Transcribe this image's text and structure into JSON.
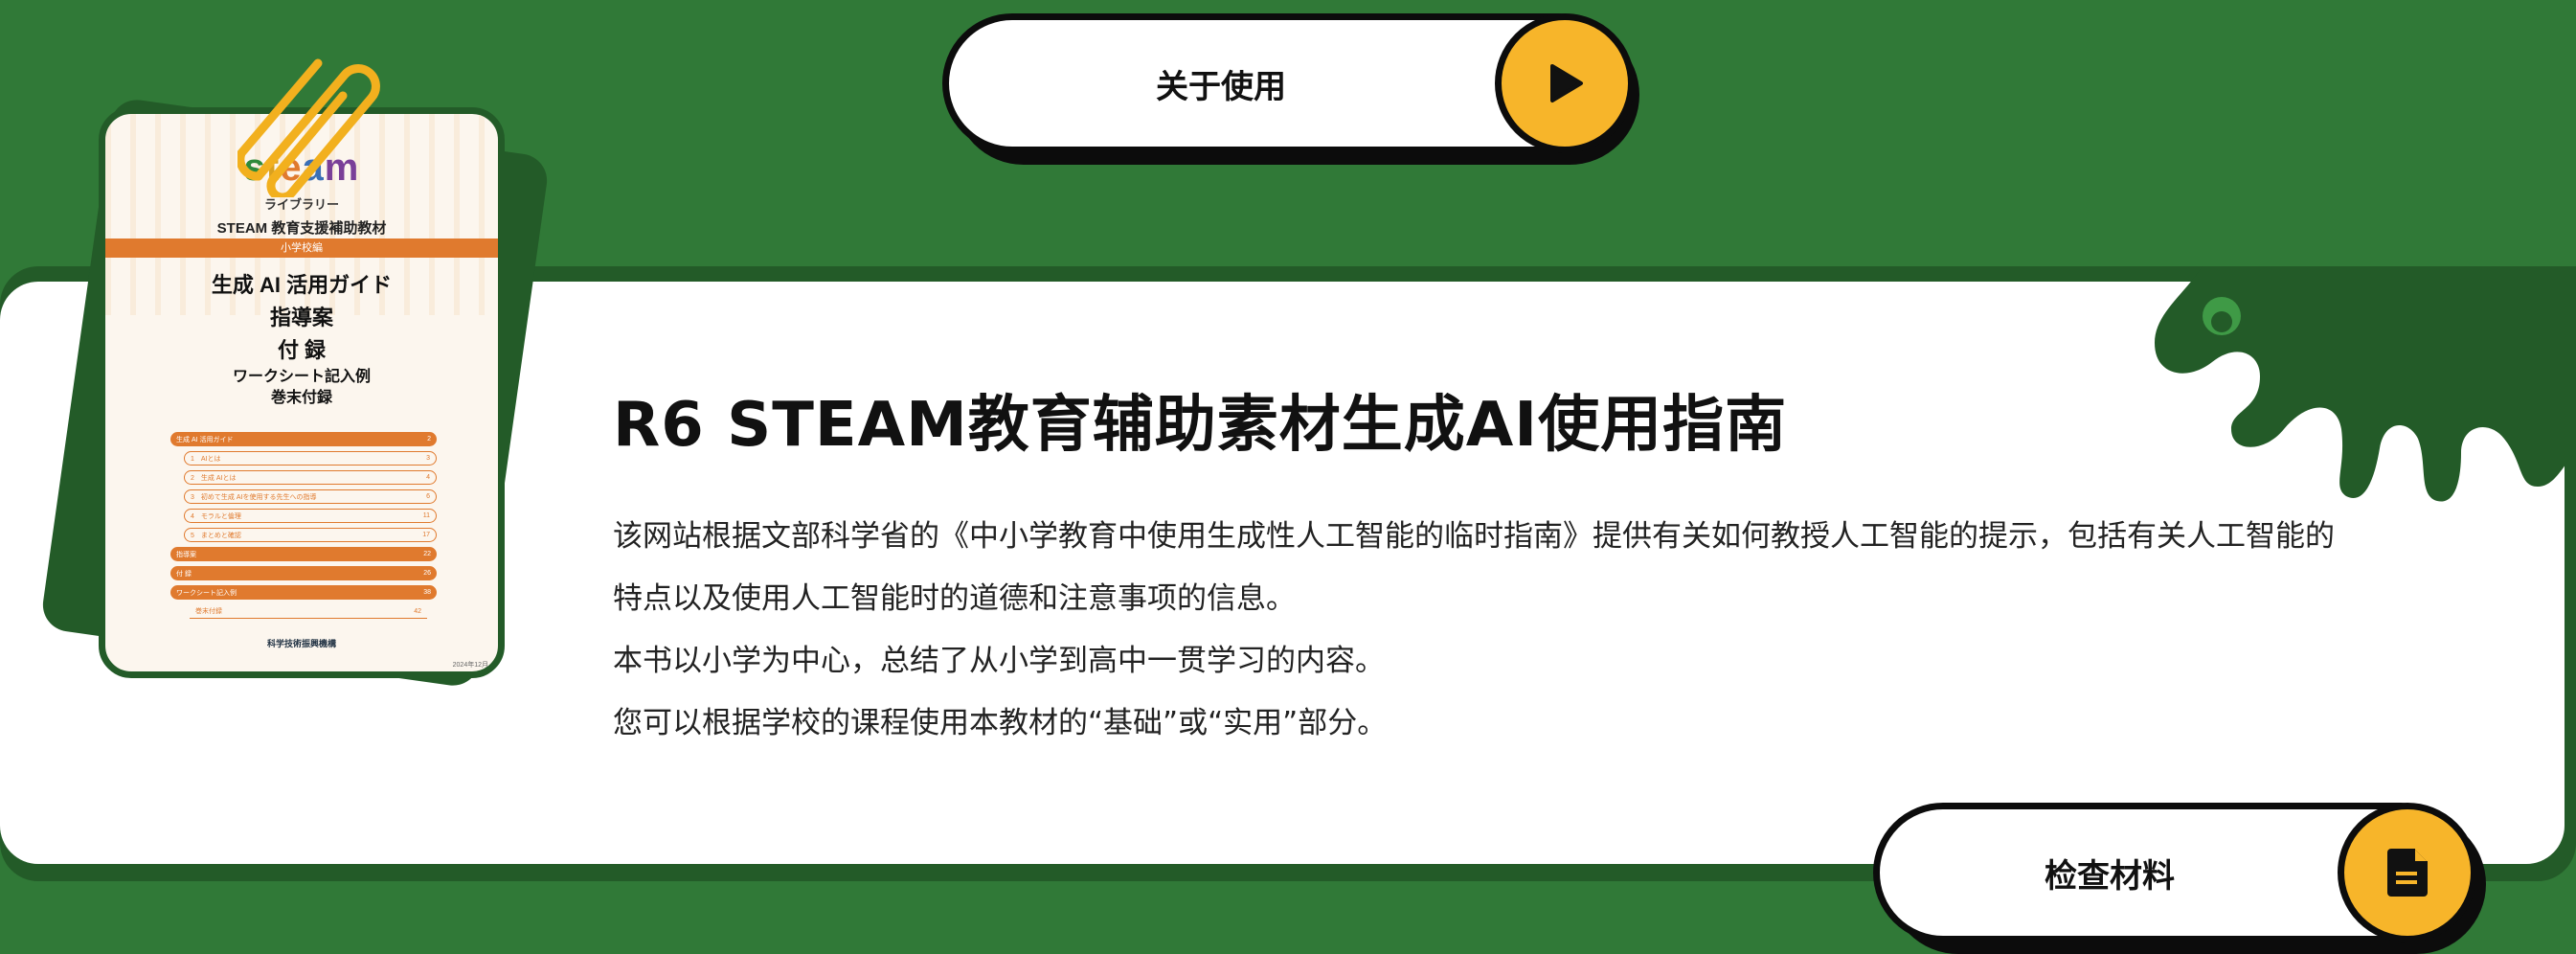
{
  "top_button": {
    "label": "关于使用",
    "icon": "play-icon"
  },
  "book": {
    "logo": "steam",
    "logo_sub": "ライブラリー",
    "series": "STEAM 教育支援補助教材",
    "ribbon": "小学校編",
    "title_lines": [
      "生成 AI 活用ガイド",
      "指導案",
      "付 録"
    ],
    "sub_lines": [
      "ワークシート記入例",
      "巻末付録"
    ],
    "toc": [
      {
        "label": "生成 AI 活用ガイド",
        "page": "2"
      },
      {
        "label": "1　AIとは",
        "page": "3"
      },
      {
        "label": "2　生成 AIとは",
        "page": "4"
      },
      {
        "label": "3　初めて生成 AIを使用する先生への指導",
        "page": "6"
      },
      {
        "label": "4　モラルと倫理",
        "page": "11"
      },
      {
        "label": "5　まとめと確認",
        "page": "17"
      },
      {
        "label": "指導案",
        "page": "22"
      },
      {
        "label": "付 録",
        "page": "26"
      },
      {
        "label": "ワークシート記入例",
        "page": "38"
      },
      {
        "label": "巻末付録",
        "page": "42"
      }
    ],
    "publisher": "科学技術振興機構",
    "date": "2024年12月"
  },
  "main": {
    "title": "R6 STEAM教育辅助素材生成AI使用指南",
    "paragraphs": [
      "该网站根据文部科学省的《中小学教育中使用生成性人工智能的临时指南》提供有关如何教授人工智能的提示，包括有关人工智能的",
      "特点以及使用人工智能时的道德和注意事项的信息。",
      "本书以小学为中心，总结了从小学到高中一贯学习的内容。",
      "您可以根据学校的课程使用本教材的“基础”或“实用”部分。"
    ]
  },
  "bottom_button": {
    "label": "检查材料",
    "icon": "document-icon"
  },
  "colors": {
    "background": "#307937",
    "dark_green": "#235b28",
    "card": "#ffffff",
    "accent_yellow": "#f7b52a",
    "orange": "#e07a2e"
  }
}
